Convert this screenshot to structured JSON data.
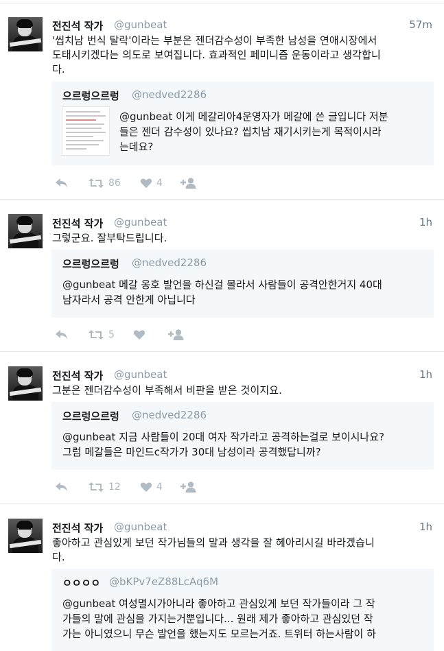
{
  "tweets": [
    {
      "name": "전진석 작가",
      "handle": "@gunbeat",
      "time": "57m",
      "text_lines": [
        "'씹치남 번식 탈락'이라는 부분은 젠더감수성이 부족한 남성을 연애시장에서",
        "도태시키겠다는 의도로 보여집니다. 효과적인 페미니즘 운동이라고 생각합니",
        "다."
      ],
      "quote": {
        "name": "으르렁으르렁",
        "handle": "@nedved2286",
        "has_image": true,
        "text_lines": [
          "@gunbeat  이게 메갈리아4운영자가 메갈에 쓴 글입니다 저분",
          "들은 젠더 감수성이 있나요? 씹치남 재기시키는게 목적이시라",
          "는데요?"
        ]
      },
      "retweets": "86",
      "likes": "4"
    },
    {
      "name": "전진석 작가",
      "handle": "@gunbeat",
      "time": "1h",
      "text_lines": [
        "그렇군요. 잘부탁드립니다."
      ],
      "quote": {
        "name": "으르렁으르렁",
        "handle": "@nedved2286",
        "has_image": false,
        "text_lines": [
          "@gunbeat 메갈 옹호 발언을 하신걸 몰라서 사람들이 공격안한거지 40대",
          "남자라서 공격 안한게 아닙니다"
        ]
      },
      "retweets": "5",
      "likes": ""
    },
    {
      "name": "전진석 작가",
      "handle": "@gunbeat",
      "time": "1h",
      "text_lines": [
        "그분은 젠더감수성이 부족해서 비판을 받은 것이지요."
      ],
      "quote": {
        "name": "으르렁으르렁",
        "handle": "@nedved2286",
        "has_image": false,
        "text_lines": [
          "@gunbeat 지금 사람들이 20대 여자 작가라고 공격하는걸로 보이시나요?",
          "그럼 메갈들은 마인드c작가가 30대 남성이라 공격했답니까?"
        ]
      },
      "retweets": "12",
      "likes": "4"
    },
    {
      "name": "전진석 작가",
      "handle": "@gunbeat",
      "time": "1h",
      "text_lines": [
        "좋아하고 관심있게 보던 작가님들의 말과 생각을 잘 헤아리시길 바라겠습니",
        "다."
      ],
      "quote": {
        "name": "ㅇㅇㅇㅇ",
        "handle": "@bKPv7eZ88LcAq6M",
        "has_image": false,
        "text_lines": [
          "@gunbeat 여성멸시가아니라 좋아하고 관심있게 보던 작가들이라 그 작",
          "가들의 말에 관심을 가지는거뿐입니다... 원래 제가 좋아하고 관심있던 작",
          "가는 아니였으니 무슨 발언을 했는지도 모르는거죠. 트위터 하는사람이 하"
        ]
      }
    }
  ],
  "icons": {
    "reply": "reply-icon",
    "retweet": "retweet-icon",
    "like": "heart-icon",
    "follow": "follow-icon"
  },
  "colors": {
    "handle": "#8a9ba8",
    "quote_bg": "#f5f8fa",
    "icon": "#b1bbc3"
  }
}
